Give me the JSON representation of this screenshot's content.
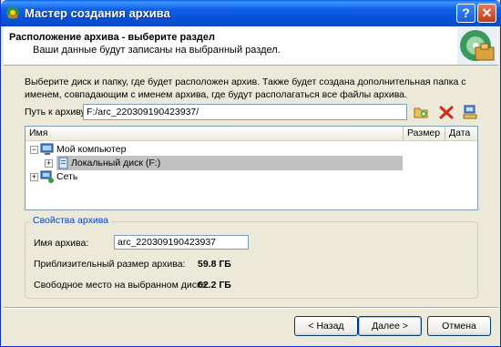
{
  "window": {
    "title": "Мастер создания архива",
    "help_label": "?",
    "close_label": "✕"
  },
  "header": {
    "title": "Расположение архива - выберите раздел",
    "subtitle": "Ваши данные будут записаны на выбранный раздел."
  },
  "description": "Выберите диск и папку, где будет расположен архив. Также будет создана дополнительная папка с именем, совпадающим с именем архива, где будут располагаться все файлы архива.",
  "path": {
    "label": "Путь к архиву:",
    "value": "F:/arc_220309190423937/"
  },
  "tree": {
    "columns": [
      "Имя",
      "Размер",
      "Дата"
    ],
    "items": [
      {
        "label": "Мой компьютер",
        "expander": "−"
      },
      {
        "label": "Локальный диск (F:)",
        "expander": "+"
      },
      {
        "label": "Сеть",
        "expander": "+"
      }
    ]
  },
  "properties": {
    "group_title": "Свойства архива",
    "name_label": "Имя архива:",
    "name_value": "arc_220309190423937",
    "size_label": "Приблизительный размер архива:",
    "size_value": "59.8 ГБ",
    "free_label": "Свободное место на выбранном диске:",
    "free_value": "62.2 ГБ"
  },
  "buttons": {
    "back": "< Назад",
    "next": "Далее >",
    "cancel": "Отмена"
  },
  "colors": {
    "titlebar": "#0a5ee6",
    "group_title": "#0046d5",
    "selection": "#c1c1c1"
  }
}
